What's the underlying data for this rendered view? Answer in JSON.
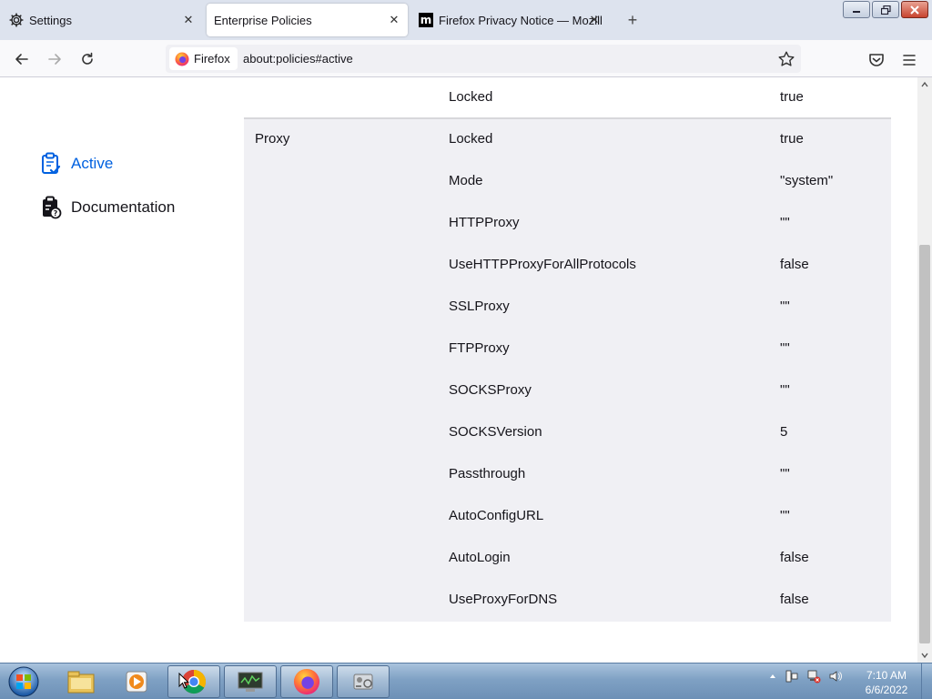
{
  "tabs": [
    {
      "title": "Settings",
      "icon": "gear-icon"
    },
    {
      "title": "Enterprise Policies",
      "icon": null
    },
    {
      "title": "Firefox Privacy Notice — Mozilla",
      "icon": "mozilla-m-icon"
    }
  ],
  "navbar": {
    "identity_label": "Firefox",
    "url": "about:policies#active"
  },
  "sidebar": {
    "items": [
      {
        "label": "Active",
        "icon": "clipboard-check-icon",
        "selected": true
      },
      {
        "label": "Documentation",
        "icon": "clipboard-question-icon",
        "selected": false
      }
    ]
  },
  "policies": {
    "top_row": {
      "name": "Locked",
      "value": "true"
    },
    "proxy": {
      "policy": "Proxy",
      "rows": [
        {
          "name": "Locked",
          "value": "true"
        },
        {
          "name": "Mode",
          "value": "\"system\""
        },
        {
          "name": "HTTPProxy",
          "value": "\"\""
        },
        {
          "name": "UseHTTPProxyForAllProtocols",
          "value": "false"
        },
        {
          "name": "SSLProxy",
          "value": "\"\""
        },
        {
          "name": "FTPProxy",
          "value": "\"\""
        },
        {
          "name": "SOCKSProxy",
          "value": "\"\""
        },
        {
          "name": "SOCKSVersion",
          "value": "5"
        },
        {
          "name": "Passthrough",
          "value": "\"\""
        },
        {
          "name": "AutoConfigURL",
          "value": "\"\""
        },
        {
          "name": "AutoLogin",
          "value": "false"
        },
        {
          "name": "UseProxyForDNS",
          "value": "false"
        }
      ]
    }
  },
  "taskbar": {
    "clock_time": "7:10 AM",
    "clock_date": "6/6/2022",
    "items": [
      "file-explorer-icon",
      "media-player-icon",
      "chrome-icon",
      "system-monitor-icon",
      "firefox-icon",
      "system-tools-icon"
    ]
  },
  "colors": {
    "accent": "#0061e0",
    "tabstrip": "#dde3ee",
    "row_grey": "#f0f0f4"
  }
}
